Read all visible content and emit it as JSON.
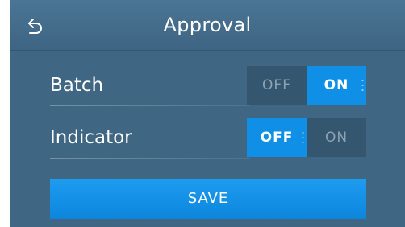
{
  "header": {
    "title": "Approval",
    "back_icon": "back-arrow-icon"
  },
  "settings": [
    {
      "label": "Batch",
      "off_label": "OFF",
      "on_label": "ON",
      "value": "ON"
    },
    {
      "label": "Indicator",
      "off_label": "OFF",
      "on_label": "ON",
      "value": "OFF"
    }
  ],
  "save_label": "SAVE",
  "colors": {
    "background": "#3f6784",
    "header": "#4a7594",
    "accent": "#0f8fe6",
    "inactive": "#34566f"
  }
}
